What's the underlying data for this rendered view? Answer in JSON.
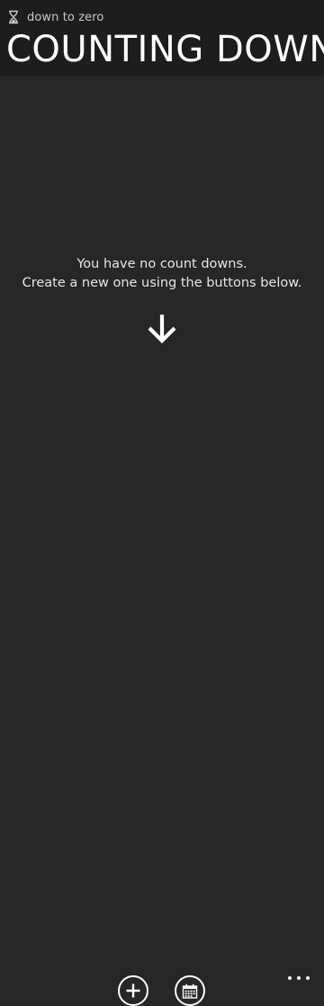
{
  "header": {
    "app_name": "down to zero",
    "page_title": "COUNTING DOWN",
    "app_icon": "hourglass-icon"
  },
  "empty_state": {
    "line1": "You have no count downs.",
    "line2": "Create a new one using the buttons below.",
    "icon": "down-arrow-icon"
  },
  "app_bar": {
    "buttons": [
      {
        "icon": "add-icon"
      },
      {
        "icon": "calendar-icon"
      }
    ],
    "more_icon": "more-dots-icon"
  },
  "colors": {
    "background": "#272727",
    "header_background": "#1d1d1d",
    "foreground": "#ffffff",
    "subtle_text": "#c8c8c8"
  }
}
